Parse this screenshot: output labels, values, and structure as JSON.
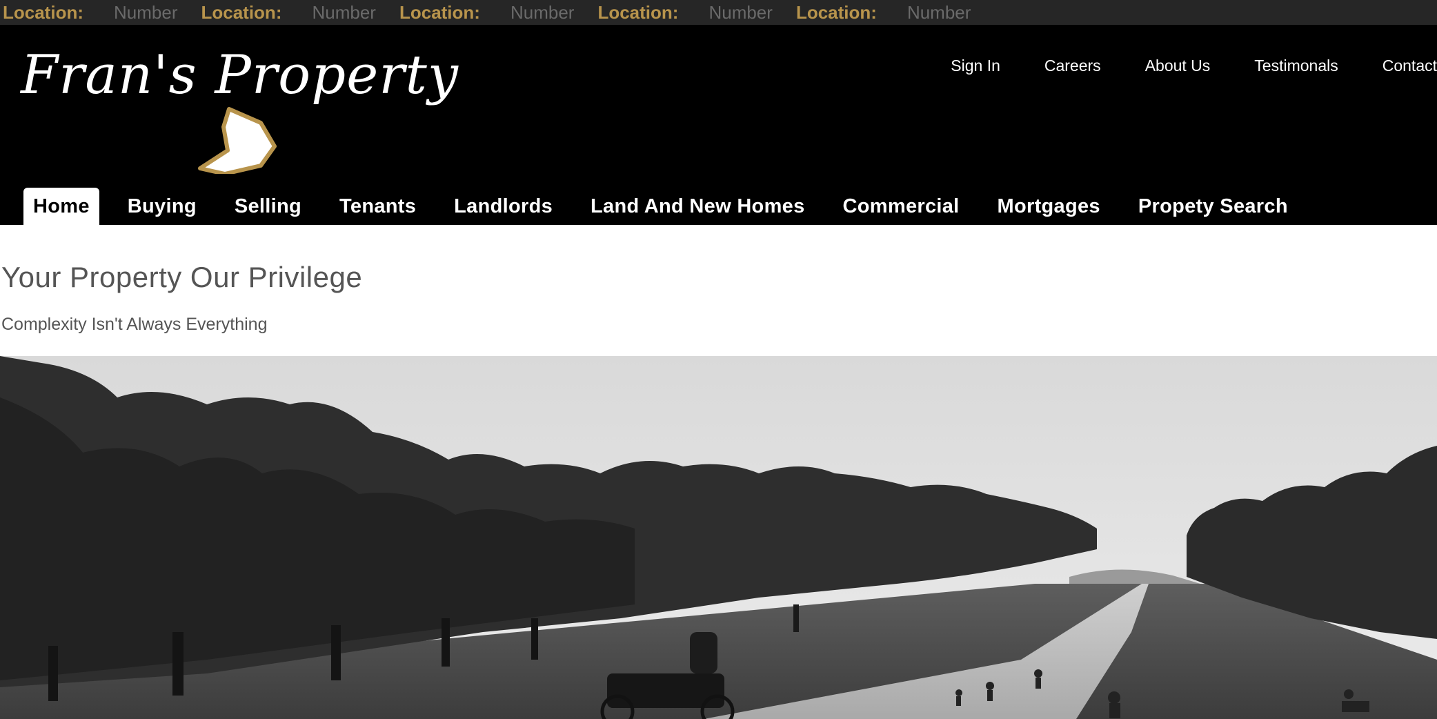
{
  "topbar": {
    "locations": [
      {
        "label": "Location:",
        "value": "Number"
      },
      {
        "label": "Location:",
        "value": "Number"
      },
      {
        "label": "Location:",
        "value": "Number"
      },
      {
        "label": "Location:",
        "value": "Number"
      },
      {
        "label": "Location:",
        "value": "Number"
      }
    ]
  },
  "header": {
    "brand": "Fran's Property",
    "utility_nav": [
      "Sign In",
      "Careers",
      "About Us",
      "Testimonals",
      "Contact"
    ],
    "main_nav": [
      "Home",
      "Buying",
      "Selling",
      "Tenants",
      "Landlords",
      "Land And New Homes",
      "Commercial",
      "Mortgages",
      "Propety Search"
    ],
    "active_tab": "Home"
  },
  "main": {
    "headline": "Your Property Our Privilege",
    "subheadline": "Complexity Isn't Always Everything"
  },
  "colors": {
    "accent_gold": "#b8944c",
    "header_bg": "#000000",
    "topbar_bg": "#262626"
  }
}
